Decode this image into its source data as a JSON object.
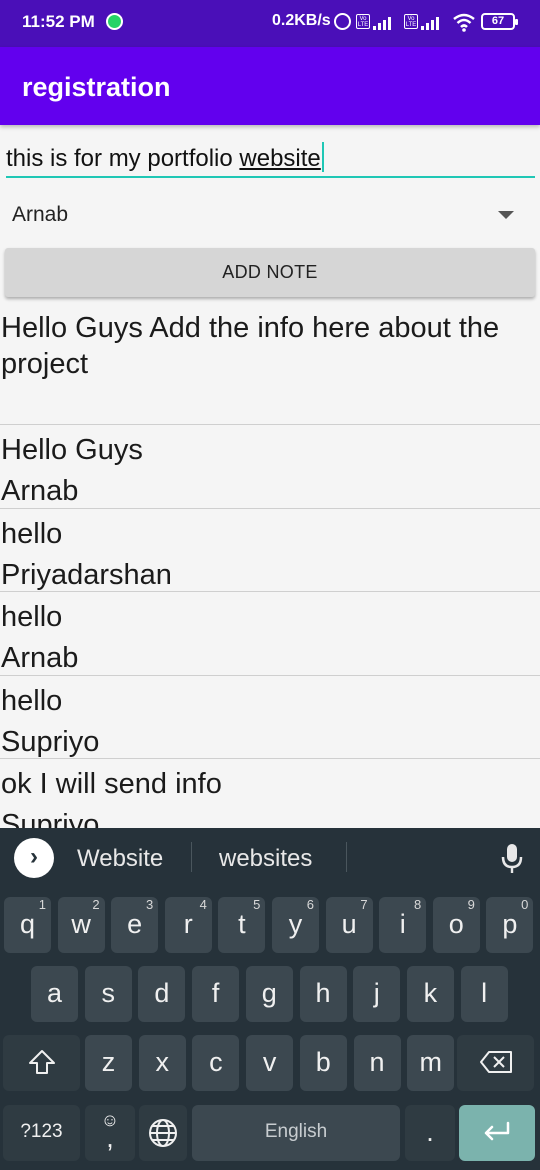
{
  "status_bar": {
    "time": "11:52 PM",
    "net_speed": "0.2KB/s",
    "volte": "Vo LTE",
    "battery": "67"
  },
  "app_bar": {
    "title": "registration"
  },
  "note_input": {
    "value_plain": "this is for my portfolio ",
    "value_underlined": "website"
  },
  "spinner": {
    "selected": "Arnab"
  },
  "add_button": {
    "label": "ADD NOTE"
  },
  "info_text": "Hello Guys Add the info here about the project",
  "notes": [
    {
      "message": "Hello Guys",
      "author": "Arnab"
    },
    {
      "message": "hello",
      "author": "Priyadarshan"
    },
    {
      "message": "hello",
      "author": "Arnab"
    },
    {
      "message": "hello",
      "author": "Supriyo"
    },
    {
      "message": "ok I will send info",
      "author": "Supriyo"
    }
  ],
  "keyboard": {
    "suggestions": [
      "Website",
      "websites"
    ],
    "row1": [
      {
        "k": "q",
        "h": "1"
      },
      {
        "k": "w",
        "h": "2"
      },
      {
        "k": "e",
        "h": "3"
      },
      {
        "k": "r",
        "h": "4"
      },
      {
        "k": "t",
        "h": "5"
      },
      {
        "k": "y",
        "h": "6"
      },
      {
        "k": "u",
        "h": "7"
      },
      {
        "k": "i",
        "h": "8"
      },
      {
        "k": "o",
        "h": "9"
      },
      {
        "k": "p",
        "h": "0"
      }
    ],
    "row2": [
      "a",
      "s",
      "d",
      "f",
      "g",
      "h",
      "j",
      "k",
      "l"
    ],
    "row3": [
      "z",
      "x",
      "c",
      "v",
      "b",
      "n",
      "m"
    ],
    "symbols_label": "?123",
    "comma_label": ",",
    "space_label": "English",
    "period_label": "."
  },
  "colors": {
    "status_bar": "#4a0fb8",
    "app_bar": "#6200ee",
    "input_underline": "#1fc7b5",
    "keyboard_bg": "#26323a",
    "enter_key": "#7bb3ad"
  }
}
